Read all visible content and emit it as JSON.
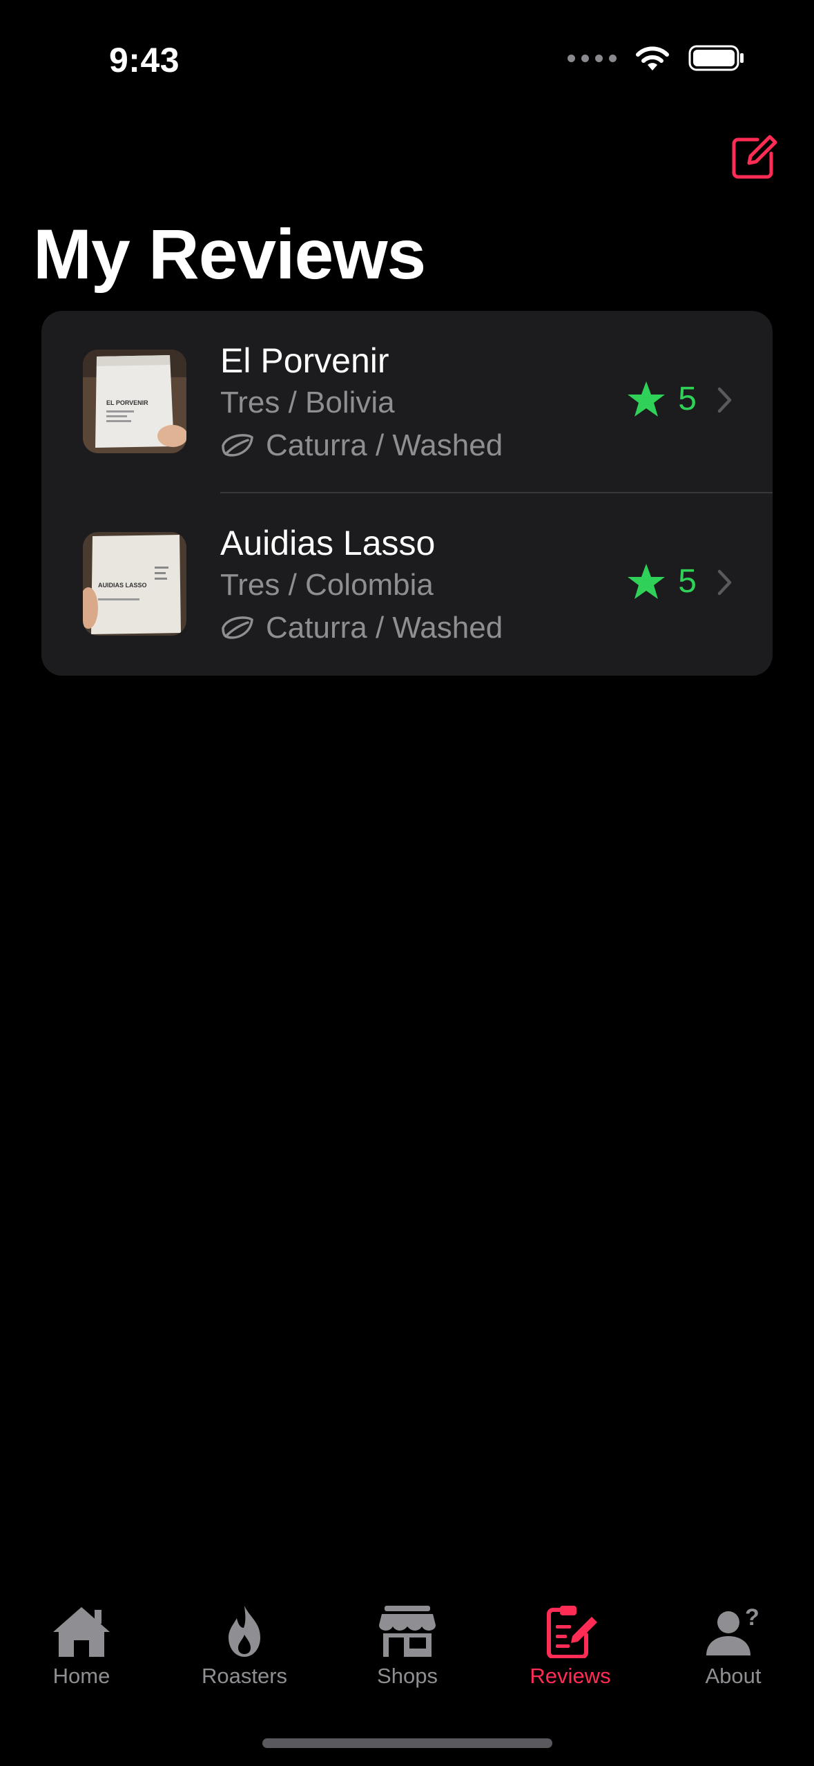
{
  "status_bar": {
    "time": "9:43"
  },
  "header": {
    "title": "My Reviews",
    "compose_icon": "square-and-pencil-icon"
  },
  "reviews": [
    {
      "name": "El Porvenir",
      "roaster_origin": "Tres / Bolivia",
      "variety_process": "Caturra / Washed",
      "rating": "5",
      "thumb_label": "EL PORVENIR"
    },
    {
      "name": "Auidias Lasso",
      "roaster_origin": "Tres / Colombia",
      "variety_process": "Caturra / Washed",
      "rating": "5",
      "thumb_label": "AUIDIAS LASSO"
    }
  ],
  "tabs": [
    {
      "label": "Home",
      "icon": "house-icon",
      "active": false
    },
    {
      "label": "Roasters",
      "icon": "flame-icon",
      "active": false
    },
    {
      "label": "Shops",
      "icon": "storefront-icon",
      "active": false
    },
    {
      "label": "Reviews",
      "icon": "clipboard-pencil-icon",
      "active": true
    },
    {
      "label": "About",
      "icon": "person-question-icon",
      "active": false
    }
  ],
  "colors": {
    "accent": "#ff2d55",
    "rating": "#30d158",
    "card": "#1c1c1e",
    "secondary_text": "#8e8e93"
  }
}
